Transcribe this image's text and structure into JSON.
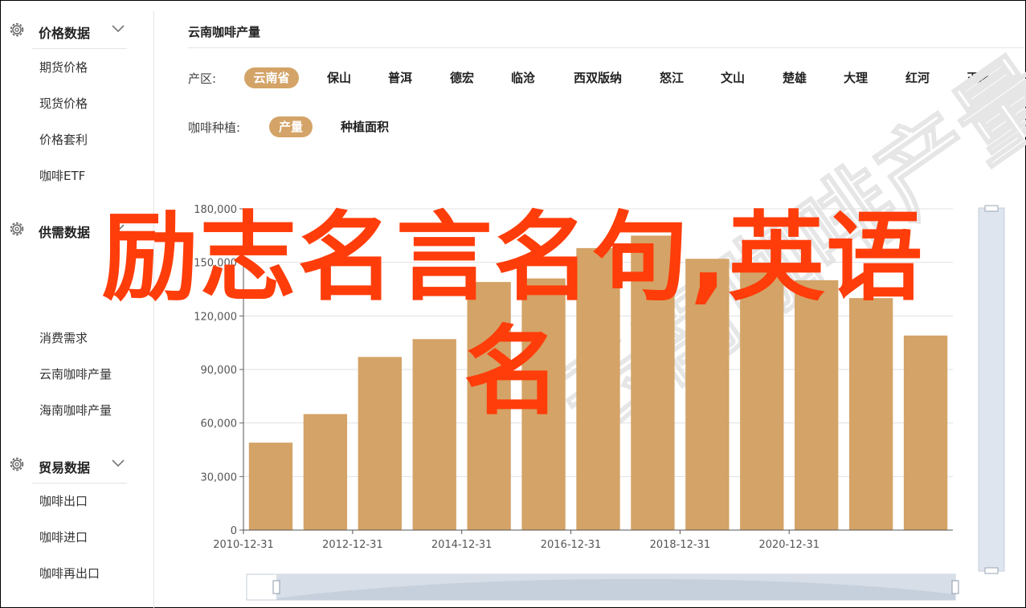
{
  "sidebar": {
    "groups": [
      {
        "title": "价格数据",
        "items": [
          "期货价格",
          "现货价格",
          "价格套利",
          "咖啡ETF"
        ]
      },
      {
        "title": "供需数据",
        "items": [
          "消费需求",
          "云南咖啡产量",
          "海南咖啡产量"
        ]
      },
      {
        "title": "贸易数据",
        "items": [
          "咖啡出口",
          "咖啡进口",
          "咖啡再出口"
        ]
      }
    ]
  },
  "panel": {
    "title": "云南咖啡产量"
  },
  "filters": {
    "region_label": "产区:",
    "regions": [
      "云南省",
      "保山",
      "普洱",
      "德宏",
      "临沧",
      "西双版纳",
      "怒江",
      "文山",
      "楚雄",
      "大理",
      "红河",
      "玉溪"
    ],
    "region_active": "云南省",
    "crop_label": "咖啡种植:",
    "metrics": [
      "产量",
      "种植面积"
    ],
    "metric_active": "产量"
  },
  "overlay": {
    "line1": "励志名言名句,英语",
    "line2": "名"
  },
  "colors": {
    "accent": "#d4a367",
    "bar": "#d4a367",
    "overlay": "#ff3d0a",
    "slider": "#d7dee8"
  },
  "chart_data": {
    "type": "bar",
    "x_tick_labels": [
      "2010-12-31",
      "2012-12-31",
      "2014-12-31",
      "2016-12-31",
      "2018-12-31",
      "2020-12-31"
    ],
    "y_tick_labels": [
      "0",
      "30,000",
      "60,000",
      "90,000",
      "120,000",
      "150,000",
      "180,000"
    ],
    "ylim": [
      0,
      180000
    ],
    "values": [
      49000,
      65000,
      97000,
      107000,
      139000,
      141000,
      158000,
      165000,
      152000,
      146000,
      140000,
      130000,
      109000
    ],
    "grid": true
  }
}
